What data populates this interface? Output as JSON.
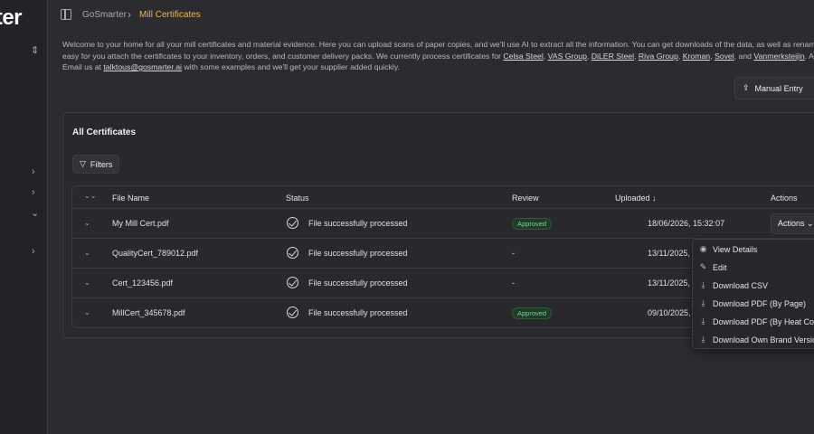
{
  "app": {
    "logo_text": "rter"
  },
  "breadcrumb": {
    "root": "GoSmarter",
    "current": "Mill Certificates"
  },
  "intro": {
    "line1": "Welcome to your home for all your mill certificates and material evidence. Here you can upload scans of paper copies, and we'll use AI to extract all the information. You can get downloads of the data, as well as renam",
    "line2_prefix": "easy for you attach the certificates to your inventory, orders, and customer delivery packs. We currently process certificates for ",
    "suppliers": [
      "Celsa Steel",
      "VAS Group",
      "DiLER Steel",
      "Riva Group",
      "Kroman",
      "Sovel"
    ],
    "and_text": ", and ",
    "last_supplier": "Vanmerksteijin",
    "line2_suffix": ". Are w",
    "line3_prefix": "Email us at ",
    "email": "talktous@gosmarter.ai",
    "line3_suffix": " with some examples and we'll get your supplier added quickly."
  },
  "toolbar": {
    "manual_entry_label": "Manual Entry"
  },
  "card": {
    "title": "All Certificates",
    "filters_label": "Filters"
  },
  "table": {
    "headers": {
      "file_name": "File Name",
      "status": "Status",
      "review": "Review",
      "uploaded": "Uploaded",
      "actions": "Actions"
    },
    "rows": [
      {
        "file": "My Mill Cert.pdf",
        "status": "File successfully processed",
        "review": "Approved",
        "uploaded": "18/06/2026, 15:32:07"
      },
      {
        "file": "QualityCert_789012.pdf",
        "status": "File successfully processed",
        "review": "-",
        "uploaded": "13/11/2025,"
      },
      {
        "file": "Cert_123456.pdf",
        "status": "File successfully processed",
        "review": "-",
        "uploaded": "13/11/2025,"
      },
      {
        "file": "MillCert_345678.pdf",
        "status": "File successfully processed",
        "review": "Approved",
        "uploaded": "09/10/2025,"
      }
    ],
    "actions_button_label": "Actions"
  },
  "menu": {
    "items": [
      {
        "label": "View Details",
        "icon": "eye-icon"
      },
      {
        "label": "Edit",
        "icon": "edit-icon"
      },
      {
        "label": "Download CSV",
        "icon": "download-icon"
      },
      {
        "label": "Download PDF (By Page)",
        "icon": "download-icon"
      },
      {
        "label": "Download PDF (By Heat Code",
        "icon": "download-icon"
      },
      {
        "label": "Download Own Brand Version",
        "icon": "download-icon"
      }
    ]
  },
  "colors": {
    "accent": "#f0b54a",
    "approved_bg": "#1f3a26",
    "approved_text": "#7fd197",
    "background": "#2b2b30"
  }
}
